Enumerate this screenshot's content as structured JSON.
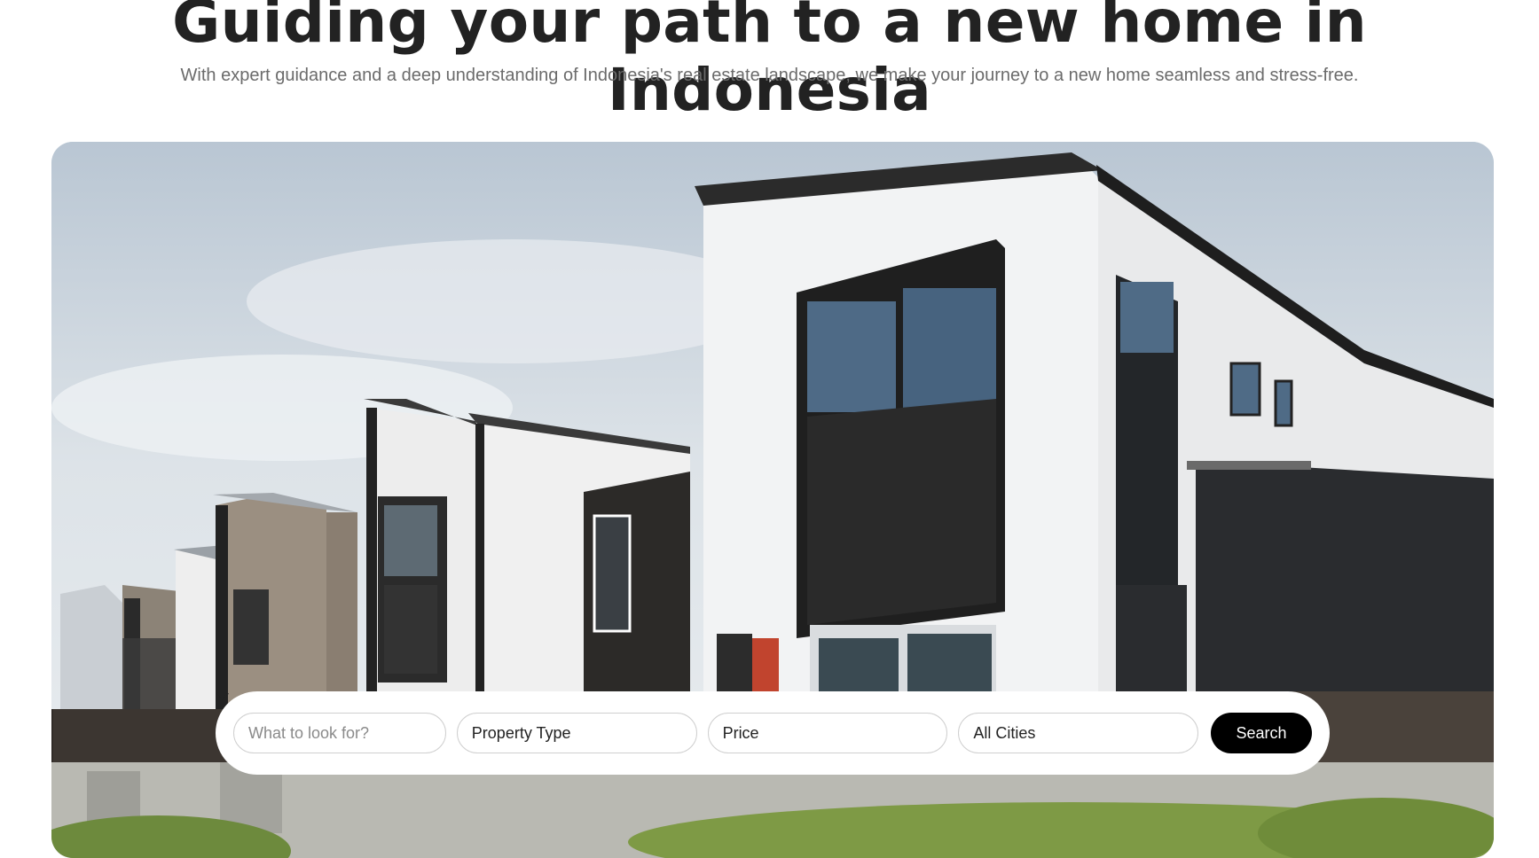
{
  "hero": {
    "headline": "Guiding your path to a new home in Indonesia",
    "subline": "With expert guidance and a deep understanding of Indonesia's real estate landscape, we make your journey to a new home seamless and stress-free.",
    "image_alt": "Modern townhouses with white and dark cladding"
  },
  "search": {
    "query_placeholder": "What to look for?",
    "query_value": "",
    "property_type": "Property Type",
    "price": "Price",
    "city": "All Cities",
    "button_label": "Search"
  },
  "icons": {
    "dropdown": "chevron-down-icon"
  },
  "colors": {
    "headline": "#222222",
    "subline": "#6b6b6b",
    "button_bg": "#000000",
    "button_text": "#ffffff"
  }
}
